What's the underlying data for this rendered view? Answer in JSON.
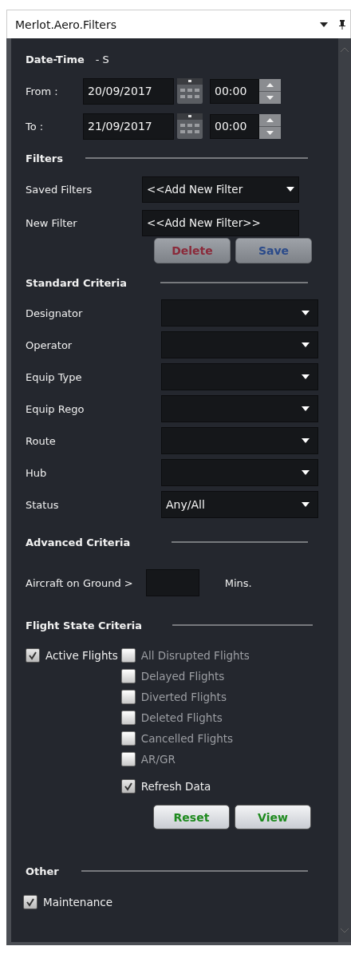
{
  "window": {
    "title": "Merlot.Aero.Filters"
  },
  "date_time": {
    "heading": "Date-Time",
    "suffix": "- S",
    "rows": [
      {
        "label": "From :",
        "date": "20/09/2017",
        "time": "00:00"
      },
      {
        "label": "To :",
        "date": "21/09/2017",
        "time": "00:00"
      }
    ]
  },
  "filters": {
    "heading": "Filters",
    "saved_label": "Saved Filters",
    "saved_value": "<<Add New Filter",
    "new_label": "New Filter",
    "new_value": "<<Add New Filter>>",
    "buttons": [
      {
        "label": "Delete",
        "disabled": true,
        "kind": "delete"
      },
      {
        "label": "Save",
        "disabled": true,
        "kind": "save"
      }
    ]
  },
  "standard_criteria": {
    "heading": "Standard Criteria",
    "fields": [
      {
        "label": "Designator"
      },
      {
        "label": "Operator"
      },
      {
        "label": "Equip Type"
      },
      {
        "label": "Equip Rego"
      },
      {
        "label": "Route"
      },
      {
        "label": "Hub"
      },
      {
        "label": "Status",
        "value": "Any/All"
      }
    ]
  },
  "advanced_criteria": {
    "heading": "Advanced Criteria",
    "label": "Aircraft on Ground >",
    "unit": "Mins."
  },
  "flight_state": {
    "heading": "Flight State Criteria",
    "active": {
      "label": "Active Flights",
      "checked": true
    },
    "options": [
      {
        "label": "All Disrupted Flights",
        "checked": false,
        "disabled": true
      },
      {
        "label": "Delayed Flights",
        "checked": false,
        "disabled": true
      },
      {
        "label": "Diverted Flights",
        "checked": false,
        "disabled": true
      },
      {
        "label": "Deleted Flights",
        "checked": false,
        "disabled": true
      },
      {
        "label": "Cancelled Flights",
        "checked": false,
        "disabled": true
      },
      {
        "label": "AR/GR",
        "checked": false,
        "disabled": true
      }
    ],
    "refresh": {
      "label": "Refresh Data",
      "checked": true
    },
    "buttons": [
      {
        "label": "Reset",
        "kind": "confirm",
        "disabled": false
      },
      {
        "label": "View",
        "kind": "confirm",
        "disabled": false
      }
    ]
  },
  "other": {
    "heading": "Other",
    "items": [
      {
        "label": "Maintenance",
        "checked": true
      }
    ]
  }
}
